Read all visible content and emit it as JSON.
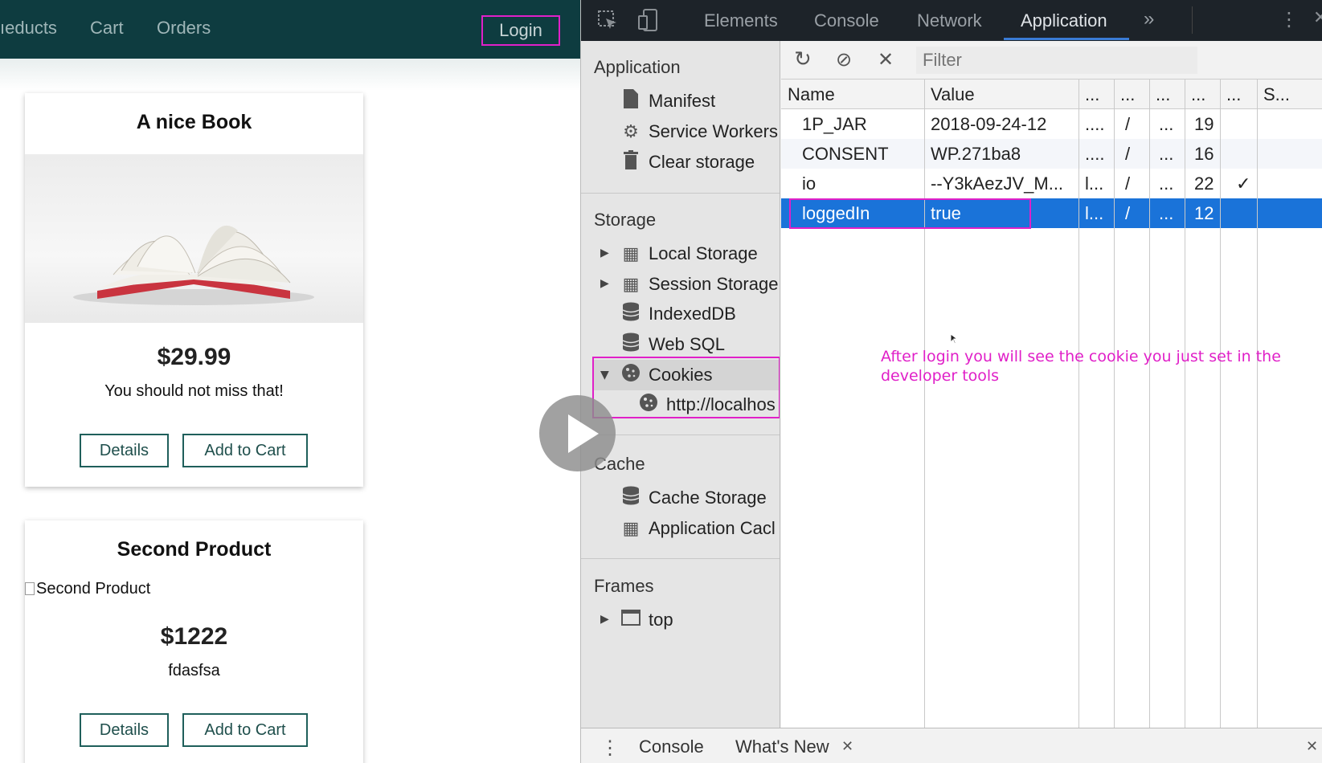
{
  "app": {
    "nav": {
      "products": "ıeducts",
      "cart": "Cart",
      "orders": "Orders",
      "login": "Login"
    },
    "products": [
      {
        "title": "A nice Book",
        "price": "$29.99",
        "description": "You should not miss that!",
        "details_label": "Details",
        "add_to_cart_label": "Add to Cart"
      },
      {
        "title": "Second Product",
        "image_alt": "Second Product",
        "price": "$1222",
        "description": "fdasfsa",
        "details_label": "Details",
        "add_to_cart_label": "Add to Cart"
      }
    ]
  },
  "devtools": {
    "tabs": [
      "Elements",
      "Console",
      "Network",
      "Application",
      "»"
    ],
    "active_tab": "Application",
    "sidebar": {
      "application_header": "Application",
      "application_items": [
        "Manifest",
        "Service Workers",
        "Clear storage"
      ],
      "storage_header": "Storage",
      "storage_items": [
        "Local Storage",
        "Session Storage",
        "IndexedDB",
        "Web SQL",
        "Cookies",
        "http://localhos"
      ],
      "cache_header": "Cache",
      "cache_items": [
        "Cache Storage",
        "Application Cacl"
      ],
      "frames_header": "Frames",
      "frames_items": [
        "top"
      ]
    },
    "filter_placeholder": "Filter",
    "table": {
      "columns": [
        "Name",
        "Value",
        "...",
        "...",
        "...",
        "...",
        "...",
        "S..."
      ],
      "rows": [
        [
          "1P_JAR",
          "2018-09-24-12",
          "....",
          "/",
          "...",
          "19",
          "",
          ""
        ],
        [
          "CONSENT",
          "WP.271ba8",
          "....",
          "/",
          "...",
          "16",
          "",
          ""
        ],
        [
          "io",
          "--Y3kAezJV_M...",
          "l...",
          "/",
          "...",
          "22",
          "✓",
          ""
        ],
        [
          "loggedIn",
          "true",
          "l...",
          "/",
          "...",
          "12",
          "",
          ""
        ]
      ],
      "selected_row": 3
    },
    "drawer": {
      "console": "Console",
      "whats_new": "What's New"
    }
  },
  "annotation": {
    "line1": "After login you will see the cookie you just set in the",
    "line2": "developer tools"
  },
  "colors": {
    "app_header": "#0e3c40",
    "highlight": "#e020c8",
    "selected_row": "#1a73d9"
  }
}
